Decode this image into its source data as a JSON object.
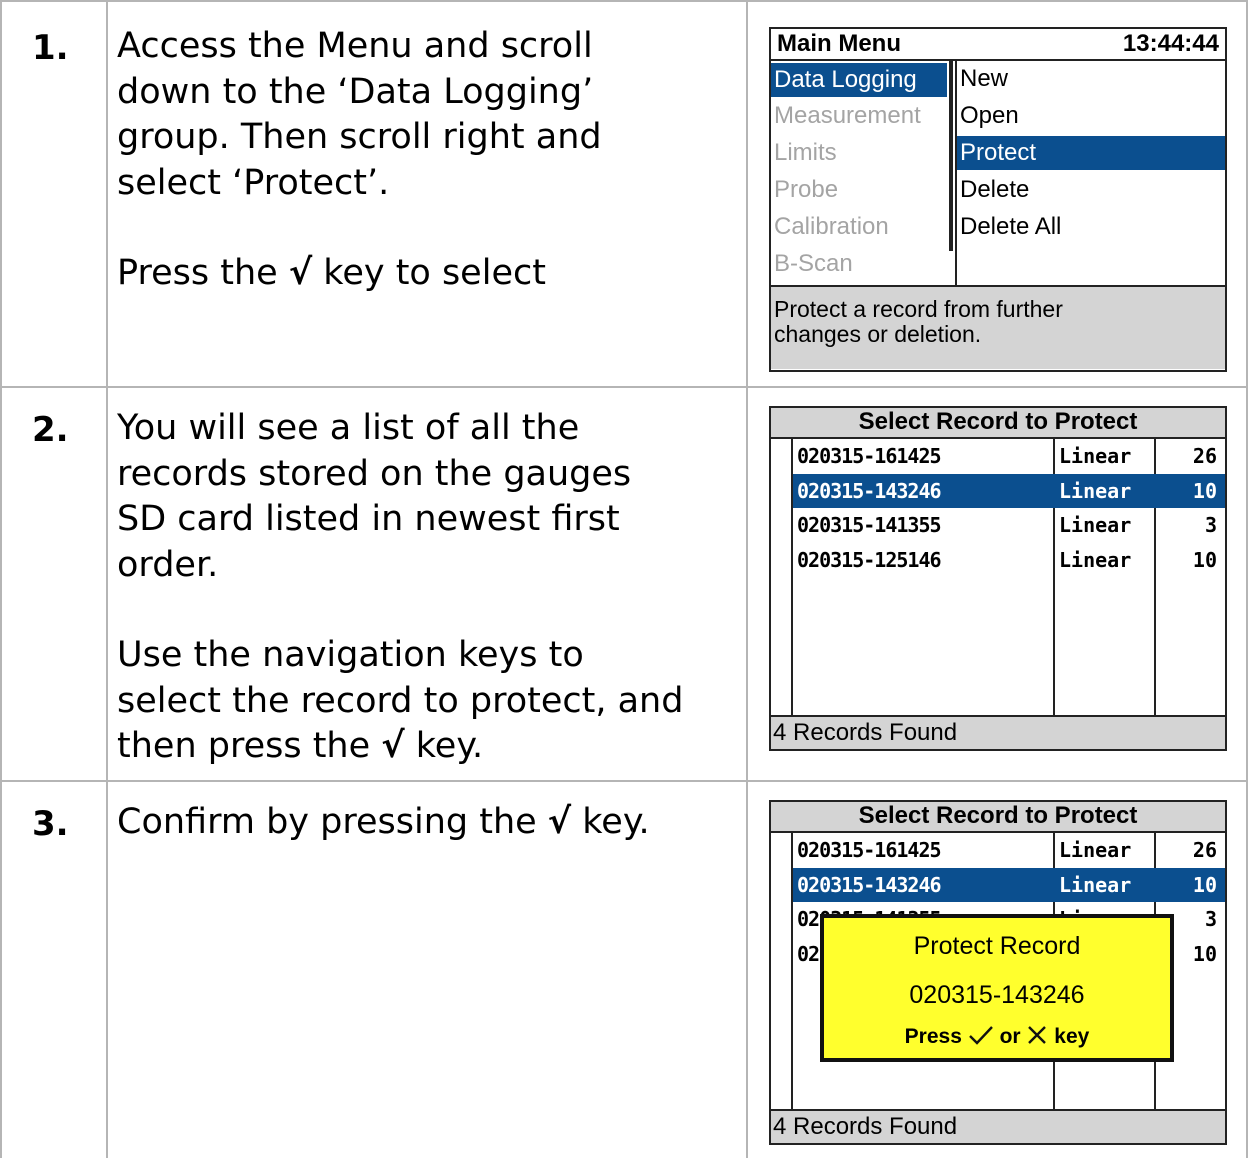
{
  "steps": [
    {
      "number": "1.",
      "lines": [
        "Access the Menu and scroll",
        "down to the ‘Data Logging’",
        "group. Then scroll right and",
        "select ‘Protect’."
      ],
      "lines2_pre": "Press the ",
      "check": "√",
      "lines2_post": " key to select"
    },
    {
      "number": "2.",
      "lines": [
        "You will see a list of all the",
        "records stored on the gauges",
        "SD card listed in newest first",
        "order."
      ],
      "lines2": [
        "Use the navigation keys to",
        "select the record to protect, and"
      ],
      "lines2_pre": "then press the ",
      "check": "√",
      "lines2_post": " key."
    },
    {
      "number": "3.",
      "pre": "Confirm by pressing the ",
      "check": "√",
      "post": " key."
    }
  ],
  "main_menu": {
    "title": "Main Menu",
    "clock": "13:44:44",
    "groups": [
      "Data Logging",
      "Measurement",
      "Limits",
      "Probe",
      "Calibration",
      "B-Scan"
    ],
    "selected_group": "Data Logging",
    "sub_items": [
      "New",
      "Open",
      "Protect",
      "Delete",
      "Delete All"
    ],
    "selected_sub": "Protect",
    "help_line1": "Protect a record from further",
    "help_line2": "changes or deletion."
  },
  "record_list": {
    "title": "Select Record to Protect",
    "rows": [
      {
        "id": "020315-161425",
        "type": "Linear",
        "count": "26"
      },
      {
        "id": "020315-143246",
        "type": "Linear",
        "count": "10"
      },
      {
        "id": "020315-141355",
        "type": "Linear",
        "count": "3"
      },
      {
        "id": "020315-125146",
        "type": "Linear",
        "count": "10"
      }
    ],
    "selected_row": 1,
    "footer": "4 Records Found"
  },
  "popup": {
    "title": "Protect Record",
    "record": "020315-143246",
    "press": "Press",
    "or": "or",
    "key": "key"
  },
  "colors": {
    "selection": "#0b4f8f",
    "popup_bg": "#ffff2d",
    "panel_grey": "#d4d4d4",
    "disabled_text": "#a4a4a4"
  }
}
